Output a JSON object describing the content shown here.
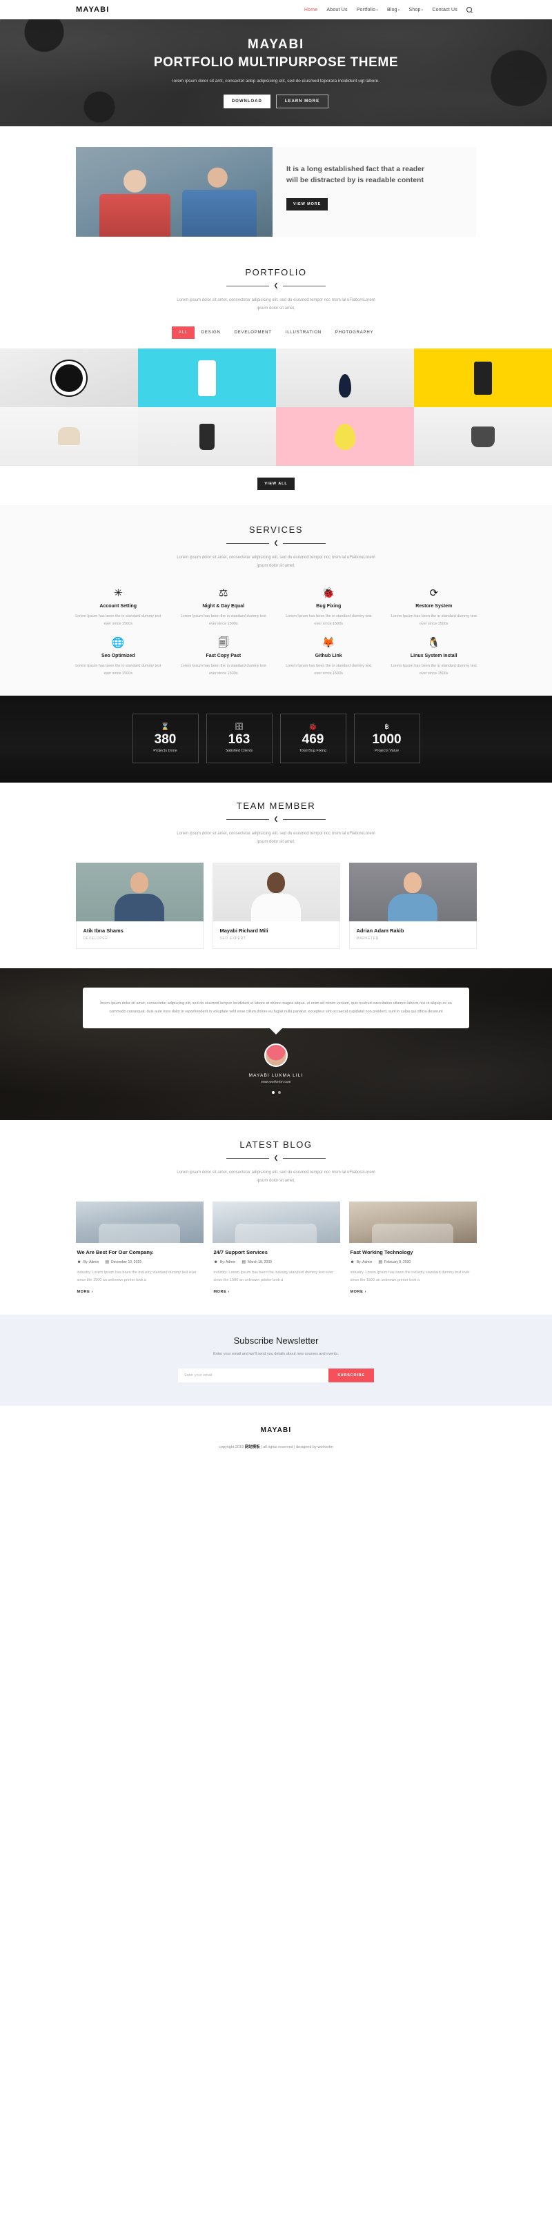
{
  "header": {
    "logo": "MAYABI",
    "nav": [
      {
        "label": "Home",
        "caret": false,
        "active": true
      },
      {
        "label": "About Us",
        "caret": false,
        "active": false
      },
      {
        "label": "Portfolio",
        "caret": true,
        "active": false
      },
      {
        "label": "Blog",
        "caret": true,
        "active": false
      },
      {
        "label": "Shop",
        "caret": true,
        "active": false
      },
      {
        "label": "Contact Us",
        "caret": false,
        "active": false
      }
    ],
    "search_icon": "search-icon"
  },
  "hero": {
    "title": "MAYABI",
    "subtitle": "PORTFOLIO MULTIPURPOSE THEME",
    "description": "lorem ipsum dolor sit amt, consectet adop adipisicing elit, sed do eiusmod teporara incididunt ugt labore.",
    "btn_primary": "DOWNLOAD",
    "btn_secondary": "LEARN MORE"
  },
  "about": {
    "heading": "It is a long established fact that a reader will be distracted by is readable content",
    "button": "VIEW MORE"
  },
  "portfolio": {
    "title": "PORTFOLIO",
    "description": "Lorem ipsum dolor sit amet, consectetur adipisicing elit, sed do eiusmod tempor ncc msm lal uFlaboreLorem ipsum dolor sit amet,",
    "filters": [
      "ALL",
      "DESIGN",
      "DEVELOPMENT",
      "ILLUSTRATION",
      "PHOTOGRAPHY"
    ],
    "active_filter": "ALL",
    "view_all": "VIEW ALL"
  },
  "services": {
    "title": "SERVICES",
    "description": "Lorem ipsum dolor sit amet, consectetur adipisicing elit, sed do eiusmod tempor ncc msm lal uFlaboreLorem ipsum dolor sit amet,",
    "items": [
      {
        "icon": "asterisk-icon",
        "glyph": "✳",
        "name": "Account Setting",
        "desc": "Lorem Ipsum has been the in standard dummy text ever since 1500s"
      },
      {
        "icon": "scales-balance-icon",
        "glyph": "⚖",
        "name": "Night & Day Equal",
        "desc": "Lorem Ipsum has been the in standard dummy text ever since 1500s"
      },
      {
        "icon": "bug-icon",
        "glyph": "🐞",
        "name": "Bug Fixing",
        "desc": "Lorem Ipsum has been the in standard dummy text ever since 1500s"
      },
      {
        "icon": "refresh-cycle-icon",
        "glyph": "⟳",
        "name": "Restore System",
        "desc": "Lorem Ipsum has been the in standard dummy text ever since 1500s"
      },
      {
        "icon": "globe-icon",
        "glyph": "🌐",
        "name": "Seo Optimized",
        "desc": "Lorem Ipsum has been the in standard dummy text ever since 1500s"
      },
      {
        "icon": "copy-files-icon",
        "glyph": "🗐",
        "name": "Fast Copy Past",
        "desc": "Lorem Ipsum has been the in standard dummy text ever since 1500s"
      },
      {
        "icon": "gitlab-fox-icon",
        "glyph": "🦊",
        "name": "Github Link",
        "desc": "Lorem Ipsum has been the in standard dummy text ever since 1500s"
      },
      {
        "icon": "linux-penguin-icon",
        "glyph": "🐧",
        "name": "Linux System Install",
        "desc": "Lorem Ipsum has been the in standard dummy text ever since 1500s"
      }
    ]
  },
  "counters": [
    {
      "icon": "hourglass-icon",
      "glyph": "⌛",
      "value": "380",
      "label": "Projects Done"
    },
    {
      "icon": "database-icon",
      "glyph": "🗄",
      "value": "163",
      "label": "Satisfied Clients"
    },
    {
      "icon": "bug-icon",
      "glyph": "🐞",
      "value": "469",
      "label": "Total Bug Fixing"
    },
    {
      "icon": "bitcoin-icon",
      "glyph": "฿",
      "value": "1000",
      "label": "Projects Value"
    }
  ],
  "team": {
    "title": "TEAM MEMBER",
    "description": "Lorem ipsum dolor sit amet, consectetur adipisicing elit, sed do eiusmod tempor ncc msm lal uFlaboreLorem ipsum dolor sit amet,",
    "members": [
      {
        "name": "Atik Ibna Shams",
        "role": "DEVELOPER"
      },
      {
        "name": "Mayabi Richard Mili",
        "role": "SEO EXPERT"
      },
      {
        "name": "Adrian Adam Rakib",
        "role": "MARKETER"
      }
    ]
  },
  "testimonial": {
    "quote": "lorem ipsum dolor sit amet, consectetur adipiscing elit, sed do eiusmod tempor incididunt ut labore et dolore magna aliqua. ut enim ad minim veniam, quis nostrud exercitation ullamco laboris nisi ut aliquip ex ea commodo consequat. duis aute irure dolor in reprehenderit in voluptate velit esse cillum dolore eu fugiat nulla pariatur. excepteur sint occaecat cupidatat non proident, sunt in culpa qui officia deserunt",
    "author": "MAYABI LUKMA LILI",
    "website": "www.workertm.com",
    "dots": 2,
    "active_dot": 0
  },
  "blog": {
    "title": "LATEST BLOG",
    "description": "Lorem ipsum dolor sit amet, consectetur adipisicing elit, sed do eiusmod tempor ncc msm lal uFlaboreLorem ipsum dolor sit amet,",
    "posts": [
      {
        "title": "We Are Best For Our Company.",
        "author": "By: Admin",
        "date": "December 10, 2019",
        "excerpt": "industry. Lorem Ipsum has been the industry standard dummy text ever since the 1500 an unknown printer took a",
        "more": "MORE ›"
      },
      {
        "title": "24/7 Support Services",
        "author": "By: Admin",
        "date": "March 18, 2000",
        "excerpt": "industry. Lorem Ipsum has been the industry standard dummy text ever since the 1500 an unknown printer took a",
        "more": "MORE ›"
      },
      {
        "title": "Fast Working Technology",
        "author": "By: Admin",
        "date": "February 8, 2030",
        "excerpt": "industry. Lorem Ipsum has been the industry standard dummy text ever since the 1500 an unknown printer took a",
        "more": "MORE ›"
      }
    ]
  },
  "newsletter": {
    "title": "Subscribe Newsletter",
    "subtitle": "Enter your email and we'll send you details about new courses and events.",
    "placeholder": "Enter your email",
    "value": "",
    "button": "SUBSCRIBE"
  },
  "footer": {
    "logo": "MAYABI",
    "copyright_pre": "copyright 2019 ",
    "copyright_brand": "网站模板",
    "copyright_post": " | all rights reserved | designed by workertm"
  },
  "colors": {
    "accent": "#f4515b",
    "dark": "#1a1a1a",
    "newsletter_bg": "#eef1f7"
  }
}
